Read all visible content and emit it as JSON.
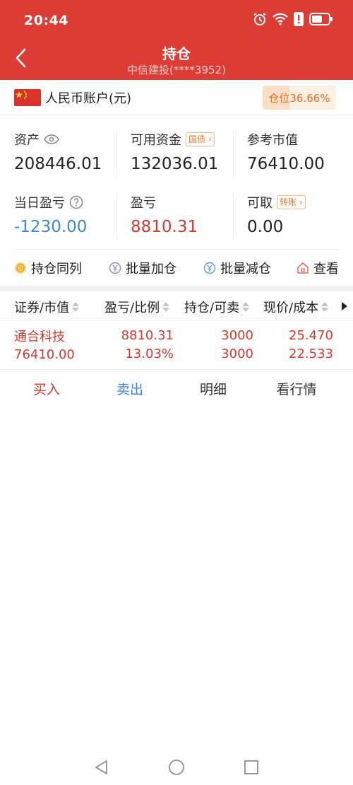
{
  "status_bar": {
    "time": "20:44"
  },
  "nav": {
    "title": "持仓",
    "subtitle": "中信建投(****3952)"
  },
  "account": {
    "label": "人民币账户(元)",
    "position_text": "仓位36.66%",
    "position_ratio": 0.3666
  },
  "summary": {
    "assets_label": "资产",
    "assets_value": "208446.01",
    "available_label": "可用资金",
    "available_tag": "国债",
    "available_value": "132036.01",
    "market_label": "参考市值",
    "market_value": "76410.00",
    "daily_pl_label": "当日盈亏",
    "daily_pl_value": "-1230.00",
    "pl_label": "盈亏",
    "pl_value": "8810.31",
    "withdrawable_label": "可取",
    "withdrawable_tag": "转账",
    "withdrawable_value": "0.00"
  },
  "actions": {
    "hold_same": "持仓同列",
    "batch_add": "批量加仓",
    "batch_reduce": "批量减仓",
    "view": "查看"
  },
  "table": {
    "headers": [
      "证券/市值",
      "盈亏/比例",
      "持仓/可卖",
      "现价/成本"
    ],
    "rows": [
      {
        "name": "通合科技",
        "market_value": "76410.00",
        "pl": "8810.31",
        "pl_ratio": "13.03%",
        "holding": "3000",
        "sellable": "3000",
        "price": "25.470",
        "cost": "22.533"
      }
    ]
  },
  "row_ops": {
    "buy": "买入",
    "sell": "卖出",
    "detail": "明细",
    "quote": "看行情"
  },
  "colors": {
    "header_red": "#dd3c35",
    "gain_red": "#d4392e",
    "loss_blue": "#3f86d9",
    "accent_orange": "#e1711e"
  }
}
